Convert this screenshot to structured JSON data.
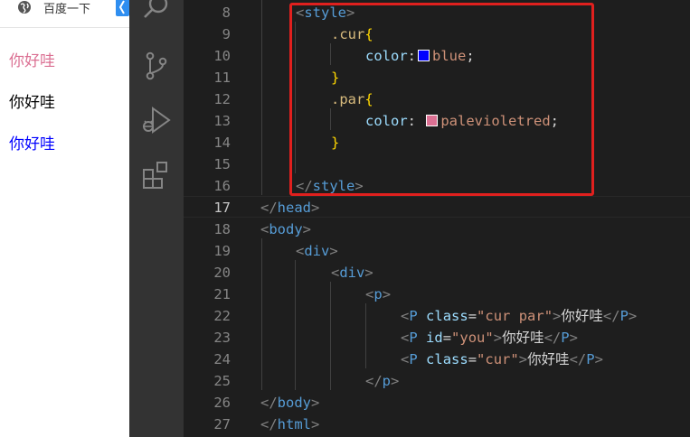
{
  "preview": {
    "bookmark_label": "百度一下",
    "lines": [
      {
        "text": "你好哇",
        "color": "#db7093"
      },
      {
        "text": "你好哇",
        "color": "#000000"
      },
      {
        "text": "你好哇",
        "color": "#0000ff"
      }
    ]
  },
  "activity_bar": {
    "icons": [
      "search-icon",
      "source-control-icon",
      "run-debug-icon",
      "extensions-icon"
    ]
  },
  "editor": {
    "active_line": 17,
    "highlight_color": "#e0201e",
    "lines": [
      {
        "n": "8",
        "t": [
          "<",
          "style",
          ">"
        ]
      },
      {
        "n": "9",
        "t": [
          ".cur",
          "{"
        ]
      },
      {
        "n": "10",
        "t": [
          "color",
          ":",
          "blue",
          ";"
        ]
      },
      {
        "n": "11",
        "t": [
          "}"
        ]
      },
      {
        "n": "12",
        "t": [
          ".par",
          "{"
        ]
      },
      {
        "n": "13",
        "t": [
          "color",
          ": ",
          "palevioletred",
          ";"
        ]
      },
      {
        "n": "14",
        "t": [
          "}"
        ]
      },
      {
        "n": "15",
        "t": []
      },
      {
        "n": "16",
        "t": [
          "</",
          "style",
          ">"
        ]
      },
      {
        "n": "17",
        "t": [
          "</",
          "head",
          ">"
        ]
      },
      {
        "n": "18",
        "t": [
          "<",
          "body",
          ">"
        ]
      },
      {
        "n": "19",
        "t": [
          "<",
          "div",
          ">"
        ]
      },
      {
        "n": "20",
        "t": [
          "<",
          "div",
          ">"
        ]
      },
      {
        "n": "21",
        "t": [
          "<",
          "p",
          ">"
        ]
      },
      {
        "n": "22",
        "t": [
          "<",
          "P",
          " ",
          "class",
          "=",
          "\"cur par\"",
          ">",
          "你好哇",
          "</",
          "P",
          ">"
        ]
      },
      {
        "n": "23",
        "t": [
          "<",
          "P",
          " ",
          "id",
          "=",
          "\"you\"",
          ">",
          "你好哇",
          "</",
          "P",
          ">"
        ]
      },
      {
        "n": "24",
        "t": [
          "<",
          "P",
          " ",
          "class",
          "=",
          "\"cur\"",
          ">",
          "你好哇",
          "</",
          "P",
          ">"
        ]
      },
      {
        "n": "25",
        "t": [
          "</",
          "p",
          ">"
        ]
      },
      {
        "n": "26",
        "t": [
          "</",
          "body",
          ">"
        ]
      },
      {
        "n": "27",
        "t": [
          "</",
          "html",
          ">"
        ]
      }
    ],
    "swatches": {
      "blue": "#0000ff",
      "palevioletred": "#db7093"
    }
  }
}
